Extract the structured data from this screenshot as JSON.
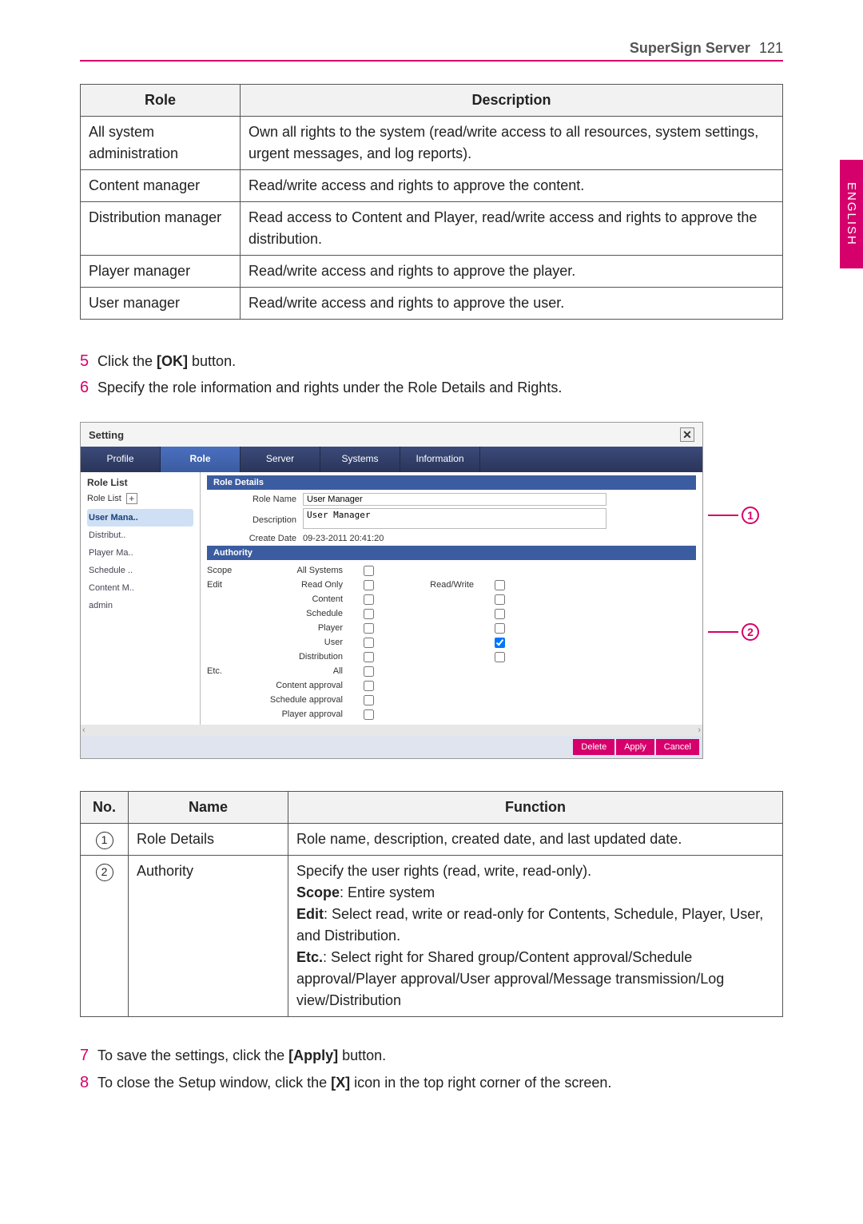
{
  "header": {
    "server": "SuperSign Server",
    "page_number": "121",
    "lang_tab": "ENGLISH"
  },
  "roles_table": {
    "col_role": "Role",
    "col_desc": "Description",
    "rows": [
      {
        "role": "All system administration",
        "desc": "Own all rights to the system (read/write access to all resources, system settings, urgent messages, and log reports)."
      },
      {
        "role": "Content manager",
        "desc": "Read/write access and rights to approve the content."
      },
      {
        "role": "Distribution manager",
        "desc": "Read access to Content and Player, read/write access and rights to approve the distribution."
      },
      {
        "role": "Player manager",
        "desc": "Read/write access and rights to approve the player."
      },
      {
        "role": "User manager",
        "desc": "Read/write access and rights to approve the user."
      }
    ]
  },
  "steps_a": [
    {
      "num": "5",
      "before": "Click the  ",
      "bold": "[OK]",
      "after": " button."
    },
    {
      "num": "6",
      "before": "Specify the role information and rights under the Role Details and Rights.",
      "bold": "",
      "after": ""
    }
  ],
  "screenshot": {
    "title": "Setting",
    "tabs": [
      "Profile",
      "Role",
      "Server",
      "Systems",
      "Information"
    ],
    "selected_tab": "Role",
    "role_list": {
      "title": "Role List",
      "header": "Role List",
      "items": [
        "User Mana..",
        "Distribut..",
        "Player Ma..",
        "Schedule ..",
        "Content M..",
        "admin"
      ],
      "selected": "User Mana.."
    },
    "details": {
      "section": "Role Details",
      "labels": {
        "name": "Role Name",
        "desc": "Description",
        "date": "Create Date"
      },
      "values": {
        "name": "User Manager",
        "desc": "User Manager",
        "date": "09-23-2011 20:41:20"
      }
    },
    "authority": {
      "section": "Authority",
      "scope_label": "Scope",
      "scope_item": "All Systems",
      "edit_label": "Edit",
      "readonly": "Read Only",
      "readwrite": "Read/Write",
      "edit_rows": [
        "Content",
        "Schedule",
        "Player",
        "User",
        "Distribution"
      ],
      "checked_user_readwrite": true,
      "etc_label": "Etc.",
      "etc_all": "All",
      "etc_rows": [
        "Content approval",
        "Schedule approval",
        "Player approval"
      ]
    },
    "footer": {
      "delete": "Delete",
      "apply": "Apply",
      "cancel": "Cancel"
    },
    "callouts": {
      "c1": "1",
      "c2": "2"
    }
  },
  "func_table": {
    "col_no": "No.",
    "col_name": "Name",
    "col_fn": "Function",
    "row1": {
      "no": "1",
      "name": "Role Details",
      "fn": "Role name, description, created date, and last updated date."
    },
    "row2": {
      "no": "2",
      "name": "Authority",
      "line1": "Specify the user rights (read, write, read-only).",
      "scope_b": "Scope",
      "scope_t": ": Entire system",
      "edit_b": "Edit",
      "edit_t": ": Select read, write or read-only for Contents, Schedule, Player, User, and Distribution.",
      "etc_b": "Etc.",
      "etc_t": ": Select right for Shared group/Content approval/Schedule approval/Player approval/User approval/Message transmission/Log view/Distribution"
    }
  },
  "steps_b": [
    {
      "num": "7",
      "before": "To save the settings, click the ",
      "bold": "[Apply]",
      "after": " button."
    },
    {
      "num": "8",
      "before": "To close the Setup window, click the ",
      "bold": "[X]",
      "after": " icon in the top right corner of the screen."
    }
  ]
}
